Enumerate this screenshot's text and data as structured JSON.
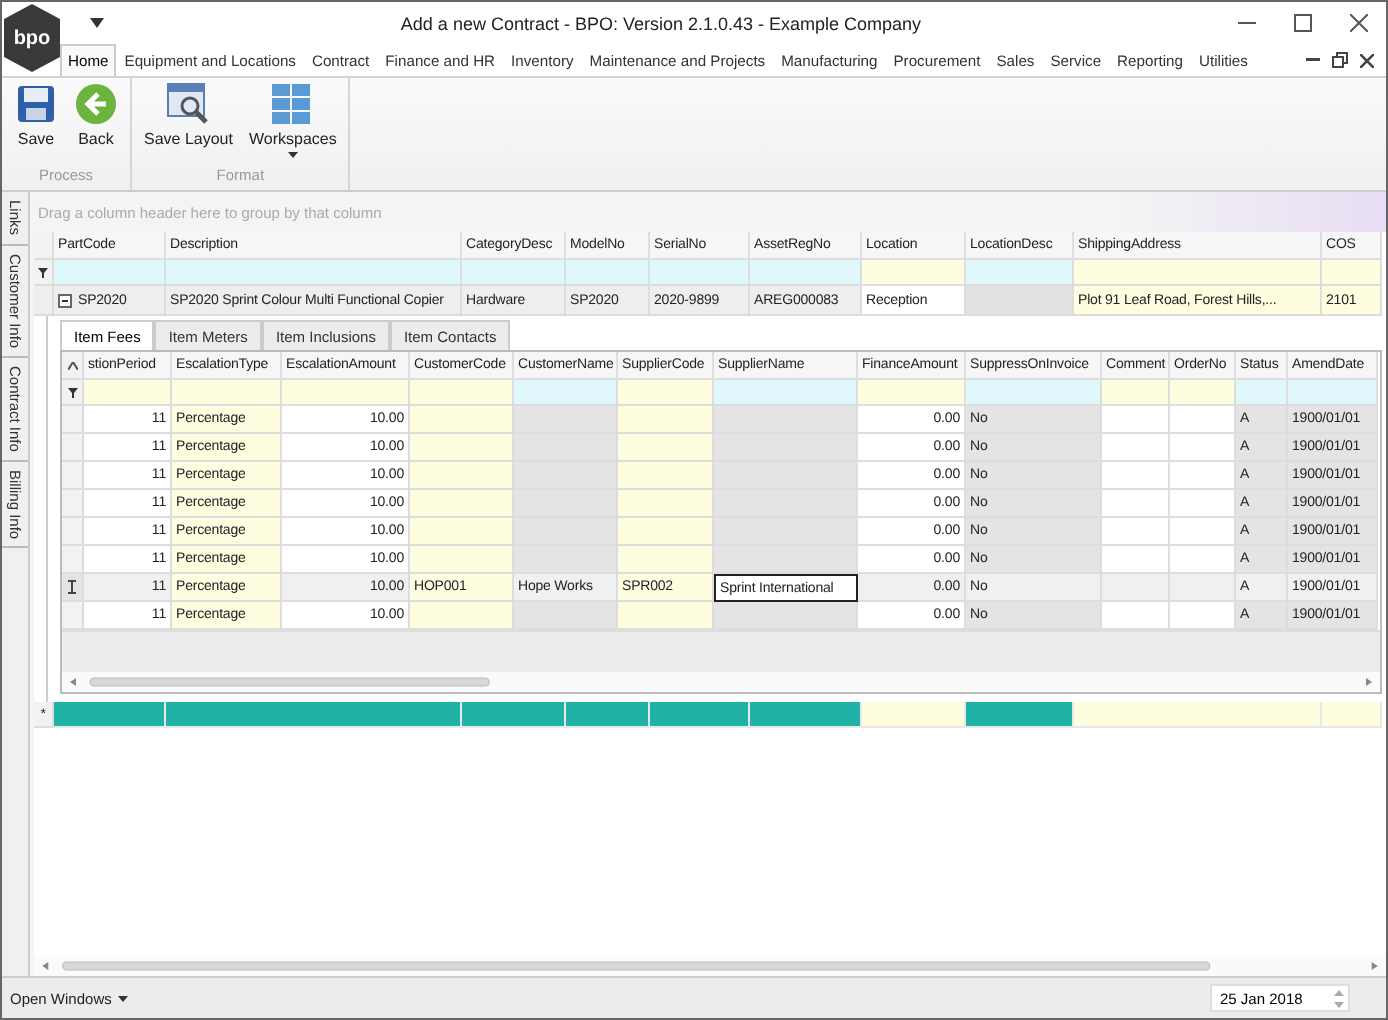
{
  "window": {
    "logo": "bpo",
    "title": "Add a new Contract - BPO: Version 2.1.0.43 - Example Company"
  },
  "ribbon": {
    "tabs": [
      {
        "label": "Home",
        "selected": true
      },
      {
        "label": "Equipment and Locations",
        "selected": false
      },
      {
        "label": "Contract",
        "selected": false
      },
      {
        "label": "Finance and HR",
        "selected": false
      },
      {
        "label": "Inventory",
        "selected": false
      },
      {
        "label": "Maintenance and Projects",
        "selected": false
      },
      {
        "label": "Manufacturing",
        "selected": false
      },
      {
        "label": "Procurement",
        "selected": false
      },
      {
        "label": "Sales",
        "selected": false
      },
      {
        "label": "Service",
        "selected": false
      },
      {
        "label": "Reporting",
        "selected": false
      },
      {
        "label": "Utilities",
        "selected": false
      }
    ],
    "groups": [
      {
        "label": "Process",
        "buttons": [
          {
            "label": "Save",
            "kind": "save",
            "dropdown": false
          },
          {
            "label": "Back",
            "kind": "back",
            "dropdown": false
          }
        ]
      },
      {
        "label": "Format",
        "buttons": [
          {
            "label": "Save Layout",
            "kind": "layout",
            "dropdown": false
          },
          {
            "label": "Workspaces",
            "kind": "workspaces",
            "dropdown": true
          }
        ]
      }
    ]
  },
  "side_tabs": [
    "Links",
    "Customer Info",
    "Contract Info",
    "Billing Info"
  ],
  "group_panel": {
    "placeholder": "Drag a column header here to group by that column"
  },
  "grid": {
    "columns": [
      {
        "name": "PartCode",
        "kind": "key"
      },
      {
        "name": "Description",
        "kind": "key"
      },
      {
        "name": "CategoryDesc",
        "kind": "key"
      },
      {
        "name": "ModelNo",
        "kind": "key"
      },
      {
        "name": "SerialNo",
        "kind": "key"
      },
      {
        "name": "AssetRegNo",
        "kind": "key"
      },
      {
        "name": "Location",
        "kind": "required"
      },
      {
        "name": "LocationDesc",
        "kind": "readonly"
      },
      {
        "name": "ShippingAddress",
        "kind": "required"
      },
      {
        "name": "COS",
        "kind": "required"
      }
    ],
    "rows": [
      {
        "expanded": true,
        "cells": [
          "SP2020",
          "SP2020 Sprint Colour Multi Functional Copier",
          "Hardware",
          "SP2020",
          "2020-9899",
          "AREG000083",
          {
            "text": "Reception",
            "editing": true
          },
          "",
          "Plot 91 Leaf Road, Forest Hills,...",
          "2101"
        ]
      }
    ],
    "detail": {
      "tabs": [
        {
          "label": "Item Fees",
          "selected": true
        },
        {
          "label": "Item Meters",
          "selected": false
        },
        {
          "label": "Item Inclusions",
          "selected": false
        },
        {
          "label": "Item Contacts",
          "selected": false
        }
      ],
      "columns": [
        {
          "name": "stionPeriod",
          "kind": "number"
        },
        {
          "name": "EscalationType",
          "kind": "required"
        },
        {
          "name": "EscalationAmount",
          "kind": "number"
        },
        {
          "name": "CustomerCode",
          "kind": "required"
        },
        {
          "name": "CustomerName",
          "kind": "readonly"
        },
        {
          "name": "SupplierCode",
          "kind": "required"
        },
        {
          "name": "SupplierName",
          "kind": "readonly"
        },
        {
          "name": "FinanceAmount",
          "kind": "number"
        },
        {
          "name": "SuppressOnInvoice",
          "kind": "readonly"
        },
        {
          "name": "Comment",
          "kind": "plain"
        },
        {
          "name": "OrderNo",
          "kind": "plain"
        },
        {
          "name": "Status",
          "kind": "readonly"
        },
        {
          "name": "AmendDate",
          "kind": "readonly"
        }
      ],
      "rows": [
        {
          "selected": false,
          "cells": [
            "11",
            "Percentage",
            "10.00",
            "",
            "",
            "",
            "",
            "0.00",
            "No",
            "",
            "",
            "A",
            "1900/01/01"
          ]
        },
        {
          "selected": false,
          "cells": [
            "11",
            "Percentage",
            "10.00",
            "",
            "",
            "",
            "",
            "0.00",
            "No",
            "",
            "",
            "A",
            "1900/01/01"
          ]
        },
        {
          "selected": false,
          "cells": [
            "11",
            "Percentage",
            "10.00",
            "",
            "",
            "",
            "",
            "0.00",
            "No",
            "",
            "",
            "A",
            "1900/01/01"
          ]
        },
        {
          "selected": false,
          "cells": [
            "11",
            "Percentage",
            "10.00",
            "",
            "",
            "",
            "",
            "0.00",
            "No",
            "",
            "",
            "A",
            "1900/01/01"
          ]
        },
        {
          "selected": false,
          "cells": [
            "11",
            "Percentage",
            "10.00",
            "",
            "",
            "",
            "",
            "0.00",
            "No",
            "",
            "",
            "A",
            "1900/01/01"
          ]
        },
        {
          "selected": false,
          "cells": [
            "11",
            "Percentage",
            "10.00",
            "",
            "",
            "",
            "",
            "0.00",
            "No",
            "",
            "",
            "A",
            "1900/01/01"
          ]
        },
        {
          "selected": true,
          "cells": [
            "11",
            "Percentage",
            "10.00",
            "HOP001",
            "Hope Works",
            "SPR002",
            {
              "text": "Sprint International",
              "editing": true
            },
            "0.00",
            "No",
            "",
            "",
            "A",
            "1900/01/01"
          ]
        },
        {
          "selected": false,
          "cells": [
            "11",
            "Percentage",
            "10.00",
            "",
            "",
            "",
            "",
            "0.00",
            "No",
            "",
            "",
            "A",
            "1900/01/01"
          ]
        }
      ]
    },
    "new_row": {
      "marker": "*"
    }
  },
  "status_bar": {
    "open_windows": "Open Windows",
    "date": "25 Jan 2018"
  }
}
